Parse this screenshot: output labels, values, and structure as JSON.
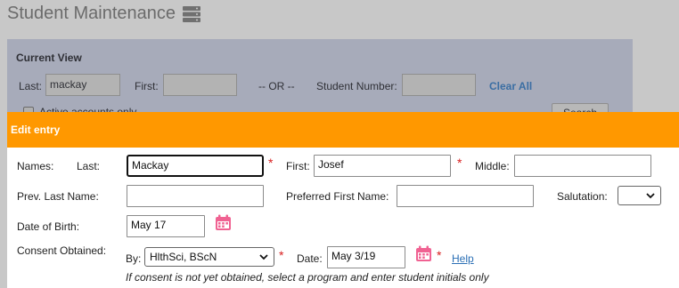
{
  "page": {
    "title": "Student Maintenance",
    "title_icon": "server-icon"
  },
  "current_view": {
    "title": "Current View",
    "last_label": "Last:",
    "last_value": "mackay",
    "first_label": "First:",
    "first_value": "",
    "or_text": "-- OR --",
    "student_number_label": "Student Number:",
    "student_number_value": "",
    "clear_all": "Clear All",
    "active_label": "Active accounts only",
    "search_button": "Search"
  },
  "edit_entry": {
    "title": "Edit entry",
    "names_label": "Names:",
    "last_label": "Last:",
    "last_value": "Mackay",
    "first_label": "First:",
    "first_value": "Josef",
    "middle_label": "Middle:",
    "middle_value": "",
    "prev_last_label": "Prev. Last Name:",
    "prev_last_value": "",
    "preferred_first_label": "Preferred First Name:",
    "preferred_first_value": "",
    "salutation_label": "Salutation:",
    "salutation_value": "",
    "dob_label": "Date of Birth:",
    "dob_value": "May 17",
    "consent_label": "Consent Obtained:",
    "by_label": "By:",
    "by_value": "HlthSci, BScN",
    "date_label": "Date:",
    "date_value": "May 3/19",
    "help_link": "Help",
    "required_marker": "*",
    "consent_note": "If consent is not yet obtained, select a program and enter student initials only"
  },
  "colors": {
    "header_orange": "#ff9800",
    "required_red": "#d81e1e",
    "calendar_pink": "#f06292",
    "link_blue": "#2a6fb5"
  }
}
